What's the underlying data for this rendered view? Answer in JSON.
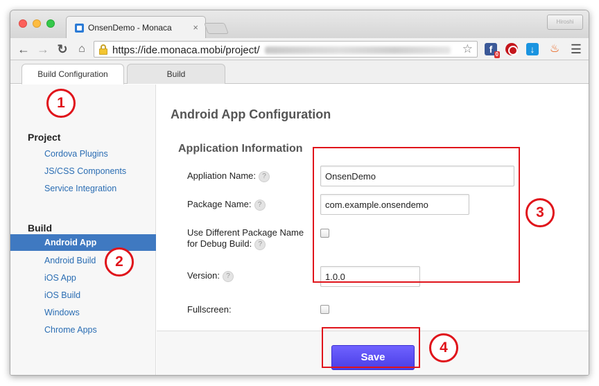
{
  "browser": {
    "tab_title": "OnsenDemo - Monaca",
    "tab_close": "×",
    "url": "https://ide.monaca.mobi/project/",
    "profile_label": "Hiroshi",
    "fb_badge": "0",
    "icons": [
      "back-arrow-icon",
      "forward-arrow-icon",
      "reload-icon",
      "home-icon",
      "lock-icon",
      "star-icon",
      "facebook-icon",
      "stop-icon",
      "download-icon",
      "fire-icon",
      "menu-icon"
    ]
  },
  "app_tabs": {
    "active": "Build Configuration",
    "inactive": "Build"
  },
  "sidebar": {
    "project_heading": "Project",
    "project_items": [
      {
        "label": "Cordova Plugins"
      },
      {
        "label": "JS/CSS Components"
      },
      {
        "label": "Service Integration"
      }
    ],
    "build_heading": "Build",
    "build_items": [
      {
        "label": "Android App"
      },
      {
        "label": "Android Build"
      },
      {
        "label": "iOS App"
      },
      {
        "label": "iOS Build"
      },
      {
        "label": "Windows"
      },
      {
        "label": "Chrome Apps"
      }
    ],
    "active_item": "Android App"
  },
  "main": {
    "page_title": "Android App Configuration",
    "section_title": "Application Information",
    "fields": {
      "app_name_label": "Appliation Name:",
      "app_name_value": "OnsenDemo",
      "package_label": "Package Name:",
      "package_value": "com.example.onsendemo",
      "debug_pkg_label_line1": "Use Different Package Name",
      "debug_pkg_label_line2": "for Debug Build:",
      "debug_pkg_checked": false,
      "version_label": "Version:",
      "version_value": "1.0.0",
      "fullscreen_label": "Fullscreen:",
      "fullscreen_checked": false
    },
    "help_glyph": "?",
    "save_label": "Save"
  },
  "annotations": {
    "one": "1",
    "two": "2",
    "three": "3",
    "four": "4",
    "color": "#e0141b"
  },
  "colors": {
    "accent": "#3f79c1",
    "link": "#2a6db3",
    "save_button": "#5a4ef5"
  }
}
